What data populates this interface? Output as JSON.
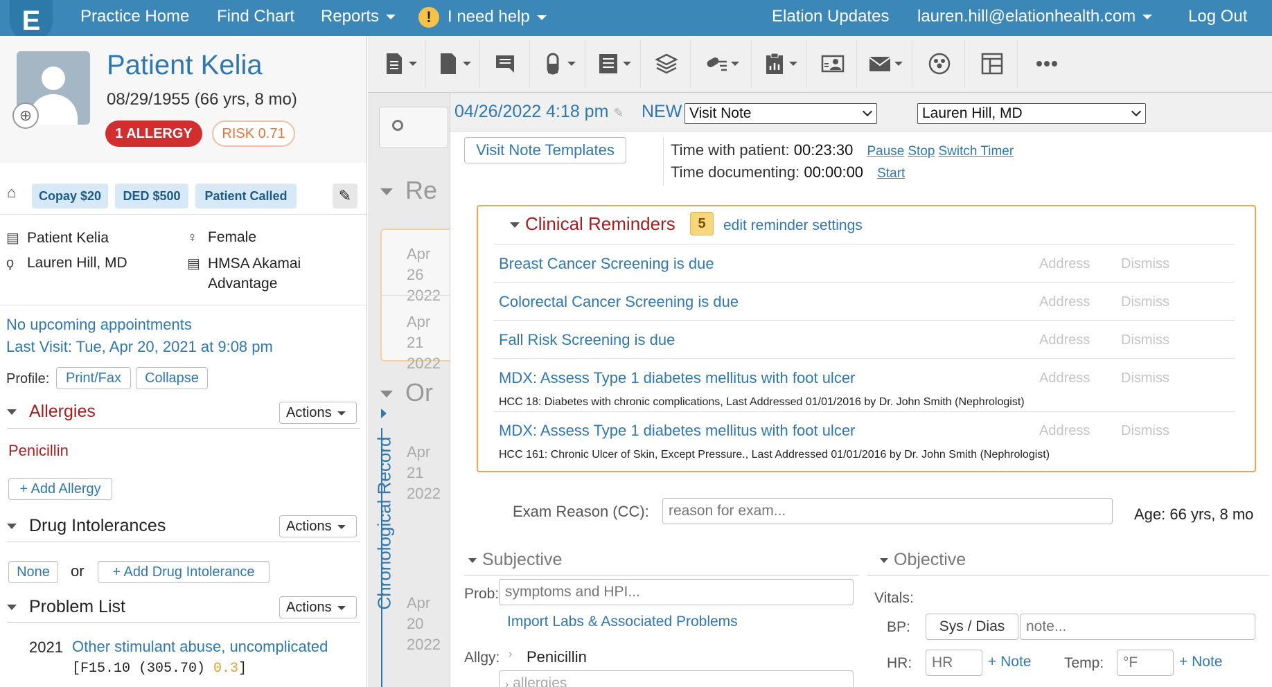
{
  "nav": {
    "practice_home": "Practice Home",
    "find_chart": "Find Chart",
    "reports": "Reports",
    "help": "I need help",
    "updates": "Elation Updates",
    "user_email": "lauren.hill@elationhealth.com",
    "logout": "Log Out"
  },
  "patient": {
    "name": "Patient Kelia",
    "dob": "08/29/1955 (66 yrs, 8 mo)",
    "allergy_badge": "1 ALLERGY",
    "risk_badge": "RISK 0.71",
    "tags": [
      "Copay $20",
      "DED $500",
      "Patient Called"
    ],
    "display_name": "Patient Kelia",
    "sex": "Female",
    "provider": "Lauren Hill, MD",
    "insurance_line1": "HMSA Akamai",
    "insurance_line2": "Advantage"
  },
  "appointments": {
    "upcoming": "No upcoming appointments",
    "last_visit": "Last Visit: Tue, Apr 20, 2021 at 9:08 pm"
  },
  "profile": {
    "label": "Profile:",
    "print_fax": "Print/Fax",
    "collapse": "Collapse"
  },
  "allergies": {
    "title": "Allergies",
    "actions": "Actions",
    "item": "Penicillin",
    "add": "+ Add Allergy"
  },
  "drug_intolerances": {
    "title": "Drug Intolerances",
    "actions": "Actions",
    "none": "None",
    "or": "or",
    "add": "+ Add Drug Intolerance"
  },
  "problem_list": {
    "title": "Problem List",
    "actions": "Actions",
    "year": "2021",
    "problem": "Other stimulant abuse, uncomplicated",
    "code": "[F15.10 (305.70) ",
    "score": "0.3",
    "code_end": "]"
  },
  "timeline": {
    "section_1": "Re",
    "section_2": "Or",
    "dates": [
      {
        "month": "Apr 26",
        "year": "2022"
      },
      {
        "month": "Apr 21",
        "year": "2022"
      },
      {
        "month": "Apr 21",
        "year": "2022"
      },
      {
        "month": "Apr 20",
        "year": "2022"
      }
    ],
    "chronological_label": "Chronological Record"
  },
  "note": {
    "datetime": "04/26/2022 4:18 pm",
    "status": "NEW",
    "type": "Visit Note",
    "provider": "Lauren Hill, MD",
    "templates_button": "Visit Note Templates",
    "time_with_patient_label": "Time with patient:",
    "time_with_patient": "00:23:30",
    "pause": "Pause",
    "stop": "Stop",
    "switch_timer": "Switch Timer",
    "time_documenting_label": "Time documenting:",
    "time_documenting": "00:00:00",
    "start": "Start"
  },
  "reminders": {
    "title": "Clinical Reminders",
    "count": "5",
    "edit": "edit reminder settings",
    "address": "Address",
    "dismiss": "Dismiss",
    "items": [
      {
        "text": "Breast Cancer Screening is due",
        "sub": ""
      },
      {
        "text": "Colorectal Cancer Screening is due",
        "sub": ""
      },
      {
        "text": "Fall Risk Screening is due",
        "sub": ""
      },
      {
        "text": "MDX: Assess Type 1 diabetes mellitus with foot ulcer",
        "sub": "HCC 18: Diabetes with chronic complications, Last Addressed 01/01/2016 by Dr. John Smith (Nephrologist)"
      },
      {
        "text": "MDX: Assess Type 1 diabetes mellitus with foot ulcer",
        "sub": "HCC 161: Chronic Ulcer of Skin, Except Pressure., Last Addressed 01/01/2016 by Dr. John Smith (Nephrologist)"
      }
    ]
  },
  "exam": {
    "label": "Exam Reason (CC):",
    "placeholder": "reason for exam...",
    "age": "Age: 66 yrs, 8 mo"
  },
  "subjective": {
    "title": "Subjective",
    "prob_label": "Prob:",
    "prob_placeholder": "symptoms and HPI...",
    "import_link": "Import Labs & Associated Problems",
    "allgy_label": "Allgy:",
    "allgy_value": "Penicillin",
    "allergies_placeholder": "allergies"
  },
  "objective": {
    "title": "Objective",
    "vitals_label": "Vitals:",
    "bp_label": "BP:",
    "bp_value": "Sys / Dias",
    "bp_note_placeholder": "note...",
    "hr_label": "HR:",
    "hr_placeholder": "HR",
    "hr_note": "+ Note",
    "temp_label": "Temp:",
    "temp_placeholder": "°F",
    "temp_note": "+ Note"
  }
}
